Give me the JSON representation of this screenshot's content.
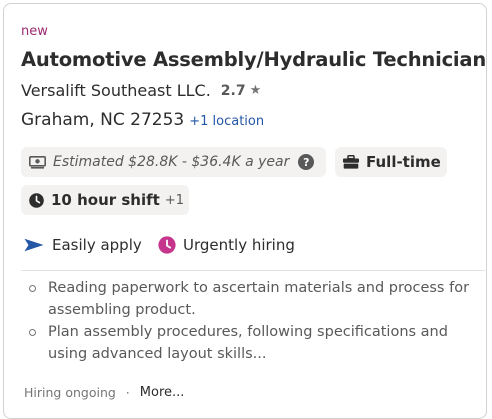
{
  "badge": "new",
  "job": {
    "title": "Automotive Assembly/Hydraulic Technician",
    "company": "Versalift Southeast LLC.",
    "rating": "2.7",
    "location": "Graham, NC 27253",
    "more_locations": "+1 location"
  },
  "attributes": {
    "salary": "Estimated $28.8K - $36.4K a year",
    "salary_help": "?",
    "job_type": "Full-time",
    "shift": "10 hour shift",
    "shift_more": "+1"
  },
  "highlights": {
    "easy_apply": "Easily apply",
    "urgent": "Urgently hiring"
  },
  "snippet": [
    "Reading paperwork to ascertain materials and process for assembling product.",
    "Plan assembly procedures, following specifications and using advanced layout skills..."
  ],
  "footer": {
    "status": "Hiring ongoing",
    "separator": "·",
    "more": "More..."
  },
  "icons": {
    "star": "star-icon",
    "salary": "money-icon",
    "job_type": "briefcase-icon",
    "shift": "clock-icon",
    "easy_apply": "send-arrow-icon",
    "urgent": "urgent-clock-icon"
  },
  "colors": {
    "badge": "#9c2b6e",
    "link": "#2557a7",
    "easy_apply_icon": "#2557a7",
    "urgent_icon": "#c6358c",
    "pill_bg": "#f3f2f1"
  }
}
